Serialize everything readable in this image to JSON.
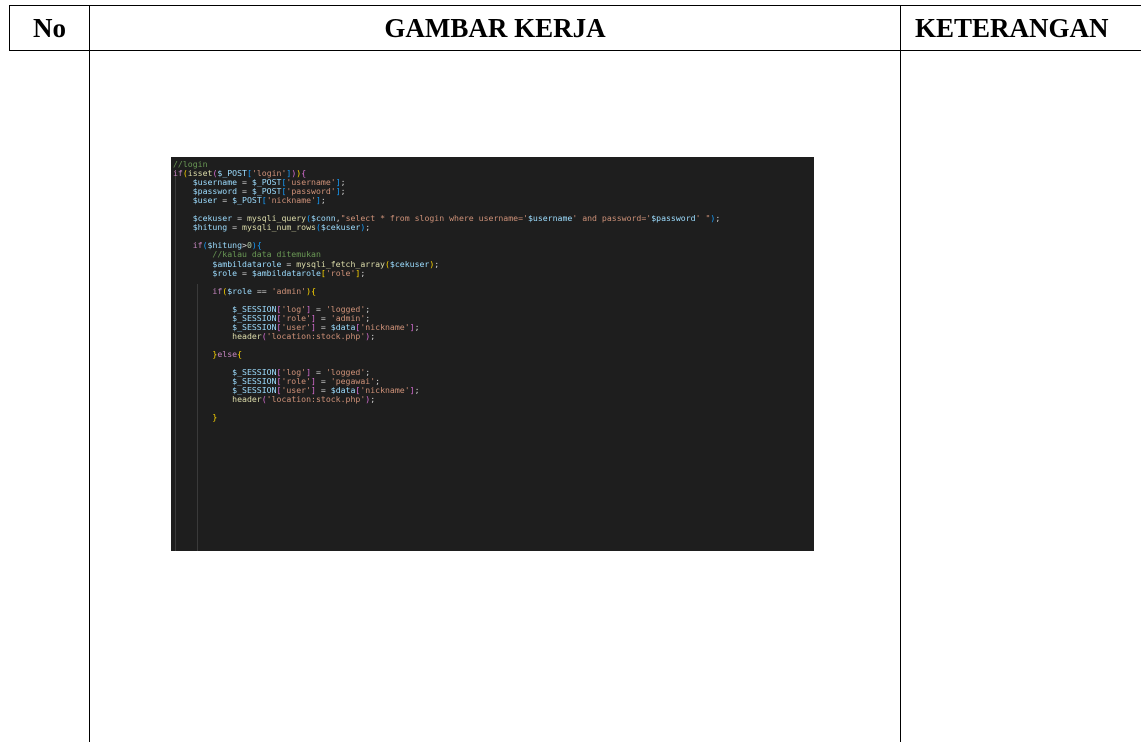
{
  "table": {
    "headers": {
      "no": "No",
      "gambar": "GAMBAR KERJA",
      "keterangan": "KETERANGAN"
    }
  },
  "code_screenshot": {
    "lines": [
      [
        {
          "t": "//login",
          "c": "comment"
        }
      ],
      [
        {
          "t": "if",
          "c": "kw"
        },
        {
          "t": "(",
          "c": "br"
        },
        {
          "t": "isset",
          "c": "fn"
        },
        {
          "t": "(",
          "c": "br2"
        },
        {
          "t": "$_POST",
          "c": "var"
        },
        {
          "t": "[",
          "c": "br3"
        },
        {
          "t": "'login'",
          "c": "str"
        },
        {
          "t": "]",
          "c": "br3"
        },
        {
          "t": ")",
          "c": "br2"
        },
        {
          "t": ")",
          "c": "br"
        },
        {
          "t": "{",
          "c": "br2"
        }
      ],
      [
        {
          "t": "    $username",
          "c": "var"
        },
        {
          "t": " = ",
          "c": "p"
        },
        {
          "t": "$_POST",
          "c": "var"
        },
        {
          "t": "[",
          "c": "br3"
        },
        {
          "t": "'username'",
          "c": "str"
        },
        {
          "t": "]",
          "c": "br3"
        },
        {
          "t": ";",
          "c": "p"
        }
      ],
      [
        {
          "t": "    $password",
          "c": "var"
        },
        {
          "t": " = ",
          "c": "p"
        },
        {
          "t": "$_POST",
          "c": "var"
        },
        {
          "t": "[",
          "c": "br3"
        },
        {
          "t": "'password'",
          "c": "str"
        },
        {
          "t": "]",
          "c": "br3"
        },
        {
          "t": ";",
          "c": "p"
        }
      ],
      [
        {
          "t": "    $user",
          "c": "var"
        },
        {
          "t": " = ",
          "c": "p"
        },
        {
          "t": "$_POST",
          "c": "var"
        },
        {
          "t": "[",
          "c": "br3"
        },
        {
          "t": "'nickname'",
          "c": "str"
        },
        {
          "t": "]",
          "c": "br3"
        },
        {
          "t": ";",
          "c": "p"
        }
      ],
      [
        {
          "t": "",
          "c": "p"
        }
      ],
      [
        {
          "t": "    $cekuser",
          "c": "var"
        },
        {
          "t": " = ",
          "c": "p"
        },
        {
          "t": "mysqli_query",
          "c": "fn"
        },
        {
          "t": "(",
          "c": "br3"
        },
        {
          "t": "$conn",
          "c": "var"
        },
        {
          "t": ",",
          "c": "p"
        },
        {
          "t": "\"select * from slogin where username='",
          "c": "str"
        },
        {
          "t": "$username",
          "c": "var"
        },
        {
          "t": "' and password='",
          "c": "str"
        },
        {
          "t": "$password",
          "c": "var"
        },
        {
          "t": "' \"",
          "c": "str"
        },
        {
          "t": ")",
          "c": "br3"
        },
        {
          "t": ";",
          "c": "p"
        }
      ],
      [
        {
          "t": "    $hitung",
          "c": "var"
        },
        {
          "t": " = ",
          "c": "p"
        },
        {
          "t": "mysqli_num_rows",
          "c": "fn"
        },
        {
          "t": "(",
          "c": "br3"
        },
        {
          "t": "$cekuser",
          "c": "var"
        },
        {
          "t": ")",
          "c": "br3"
        },
        {
          "t": ";",
          "c": "p"
        }
      ],
      [
        {
          "t": "",
          "c": "p"
        }
      ],
      [
        {
          "t": "    if",
          "c": "kw"
        },
        {
          "t": "(",
          "c": "br3"
        },
        {
          "t": "$hitung",
          "c": "var"
        },
        {
          "t": ">",
          "c": "p"
        },
        {
          "t": "0",
          "c": "num"
        },
        {
          "t": ")",
          "c": "br3"
        },
        {
          "t": "{",
          "c": "br3"
        }
      ],
      [
        {
          "t": "        //kalau data ditemukan",
          "c": "comment"
        }
      ],
      [
        {
          "t": "        $ambildatarole",
          "c": "var"
        },
        {
          "t": " = ",
          "c": "p"
        },
        {
          "t": "mysqli_fetch_array",
          "c": "fn"
        },
        {
          "t": "(",
          "c": "br"
        },
        {
          "t": "$cekuser",
          "c": "var"
        },
        {
          "t": ")",
          "c": "br"
        },
        {
          "t": ";",
          "c": "p"
        }
      ],
      [
        {
          "t": "        $role",
          "c": "var"
        },
        {
          "t": " = ",
          "c": "p"
        },
        {
          "t": "$ambildatarole",
          "c": "var"
        },
        {
          "t": "[",
          "c": "br"
        },
        {
          "t": "'role'",
          "c": "str"
        },
        {
          "t": "]",
          "c": "br"
        },
        {
          "t": ";",
          "c": "p"
        }
      ],
      [
        {
          "t": "",
          "c": "p"
        }
      ],
      [
        {
          "t": "        if",
          "c": "kw"
        },
        {
          "t": "(",
          "c": "br"
        },
        {
          "t": "$role",
          "c": "var"
        },
        {
          "t": " == ",
          "c": "p"
        },
        {
          "t": "'admin'",
          "c": "str"
        },
        {
          "t": ")",
          "c": "br"
        },
        {
          "t": "{",
          "c": "br"
        }
      ],
      [
        {
          "t": "",
          "c": "p"
        }
      ],
      [
        {
          "t": "            $_SESSION",
          "c": "var"
        },
        {
          "t": "[",
          "c": "br2"
        },
        {
          "t": "'log'",
          "c": "str"
        },
        {
          "t": "]",
          "c": "br2"
        },
        {
          "t": " = ",
          "c": "p"
        },
        {
          "t": "'logged'",
          "c": "str"
        },
        {
          "t": ";",
          "c": "p"
        }
      ],
      [
        {
          "t": "            $_SESSION",
          "c": "var"
        },
        {
          "t": "[",
          "c": "br2"
        },
        {
          "t": "'role'",
          "c": "str"
        },
        {
          "t": "]",
          "c": "br2"
        },
        {
          "t": " = ",
          "c": "p"
        },
        {
          "t": "'admin'",
          "c": "str"
        },
        {
          "t": ";",
          "c": "p"
        }
      ],
      [
        {
          "t": "            $_SESSION",
          "c": "var"
        },
        {
          "t": "[",
          "c": "br2"
        },
        {
          "t": "'user'",
          "c": "str"
        },
        {
          "t": "]",
          "c": "br2"
        },
        {
          "t": " = ",
          "c": "p"
        },
        {
          "t": "$data",
          "c": "var"
        },
        {
          "t": "[",
          "c": "br2"
        },
        {
          "t": "'nickname'",
          "c": "str"
        },
        {
          "t": "]",
          "c": "br2"
        },
        {
          "t": ";",
          "c": "p"
        }
      ],
      [
        {
          "t": "            header",
          "c": "fn"
        },
        {
          "t": "(",
          "c": "br2"
        },
        {
          "t": "'location:stock.php'",
          "c": "str"
        },
        {
          "t": ")",
          "c": "br2"
        },
        {
          "t": ";",
          "c": "p"
        }
      ],
      [
        {
          "t": "",
          "c": "p"
        }
      ],
      [
        {
          "t": "        }",
          "c": "br"
        },
        {
          "t": "else",
          "c": "kw"
        },
        {
          "t": "{",
          "c": "br"
        }
      ],
      [
        {
          "t": "",
          "c": "p"
        }
      ],
      [
        {
          "t": "            $_SESSION",
          "c": "var"
        },
        {
          "t": "[",
          "c": "br2"
        },
        {
          "t": "'log'",
          "c": "str"
        },
        {
          "t": "]",
          "c": "br2"
        },
        {
          "t": " = ",
          "c": "p"
        },
        {
          "t": "'logged'",
          "c": "str"
        },
        {
          "t": ";",
          "c": "p"
        }
      ],
      [
        {
          "t": "            $_SESSION",
          "c": "var"
        },
        {
          "t": "[",
          "c": "br2"
        },
        {
          "t": "'role'",
          "c": "str"
        },
        {
          "t": "]",
          "c": "br2"
        },
        {
          "t": " = ",
          "c": "p"
        },
        {
          "t": "'pegawai'",
          "c": "str"
        },
        {
          "t": ";",
          "c": "p"
        }
      ],
      [
        {
          "t": "            $_SESSION",
          "c": "var"
        },
        {
          "t": "[",
          "c": "br2"
        },
        {
          "t": "'user'",
          "c": "str"
        },
        {
          "t": "]",
          "c": "br2"
        },
        {
          "t": " = ",
          "c": "p"
        },
        {
          "t": "$data",
          "c": "var"
        },
        {
          "t": "[",
          "c": "br2"
        },
        {
          "t": "'nickname'",
          "c": "str"
        },
        {
          "t": "]",
          "c": "br2"
        },
        {
          "t": ";",
          "c": "p"
        }
      ],
      [
        {
          "t": "            header",
          "c": "fn"
        },
        {
          "t": "(",
          "c": "br2"
        },
        {
          "t": "'location:stock.php'",
          "c": "str"
        },
        {
          "t": ")",
          "c": "br2"
        },
        {
          "t": ";",
          "c": "p"
        }
      ],
      [
        {
          "t": "",
          "c": "p"
        }
      ],
      [
        {
          "t": "        }",
          "c": "br"
        }
      ]
    ]
  }
}
